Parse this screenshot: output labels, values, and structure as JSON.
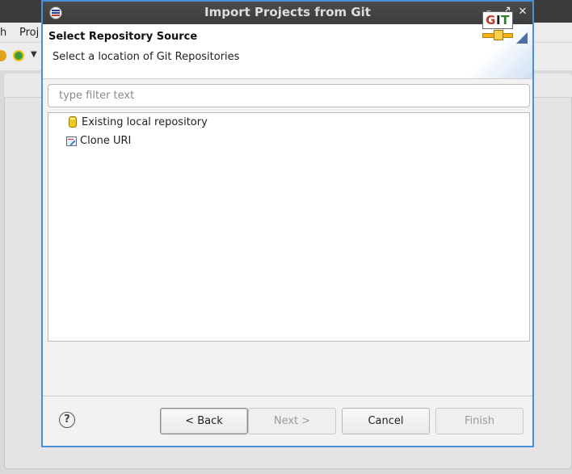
{
  "background": {
    "menu": [
      "h",
      "Proj"
    ]
  },
  "dialog": {
    "title": "Import Projects from Git",
    "window_controls": {
      "minimize": "–",
      "maximize": "⤢",
      "close": "✕"
    },
    "header": {
      "title": "Select Repository Source",
      "description": "Select a location of Git Repositories",
      "logo_text": [
        "G",
        "I",
        "T"
      ]
    },
    "filter": {
      "placeholder": "type filter text",
      "value": ""
    },
    "tree": {
      "items": [
        {
          "label": "Existing local repository",
          "icon": "git-repository-icon"
        },
        {
          "label": "Clone URI",
          "icon": "clone-uri-icon"
        }
      ]
    },
    "buttons": {
      "help": "?",
      "back": "< Back",
      "next": "Next >",
      "cancel": "Cancel",
      "finish": "Finish"
    }
  },
  "colors": {
    "accent_border": "#4a90d9",
    "titlebar": "#3d3d3d"
  }
}
